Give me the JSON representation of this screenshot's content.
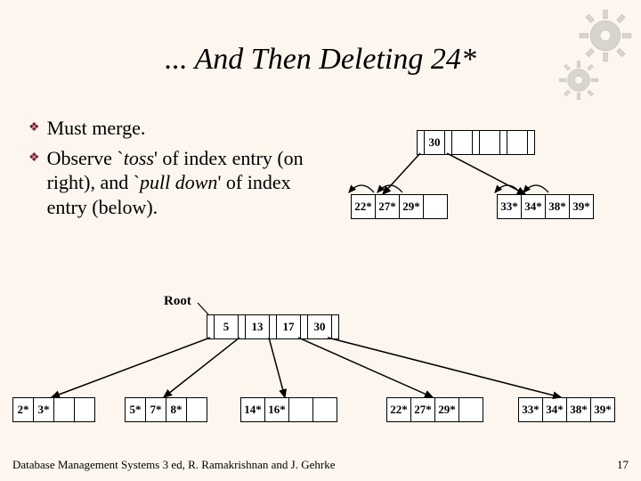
{
  "title": "... And Then Deleting 24*",
  "bullets": [
    {
      "prefix": "Must merge."
    },
    {
      "prefix": "Observe `",
      "em1": "toss",
      "mid": "' of index entry (on right), and `",
      "em2": "pull down",
      "suffix": "' of index entry (below)."
    }
  ],
  "topIndex": {
    "key": "30"
  },
  "topLeaves": {
    "left": [
      "22*",
      "27*",
      "29*"
    ],
    "right": [
      "33*",
      "34*",
      "38*",
      "39*"
    ]
  },
  "rootLabel": "Root",
  "rootKeys": [
    "5",
    "13",
    "17",
    "30"
  ],
  "bottomLeaves": [
    [
      "2*",
      "3*"
    ],
    [
      "5*",
      "7*",
      "8*"
    ],
    [
      "14*",
      "16*"
    ],
    [
      "22*",
      "27*",
      "29*"
    ],
    [
      "33*",
      "34*",
      "38*",
      "39*"
    ]
  ],
  "footer": {
    "left": "Database Management Systems 3 ed,  R. Ramakrishnan and J. Gehrke",
    "right": "17"
  }
}
